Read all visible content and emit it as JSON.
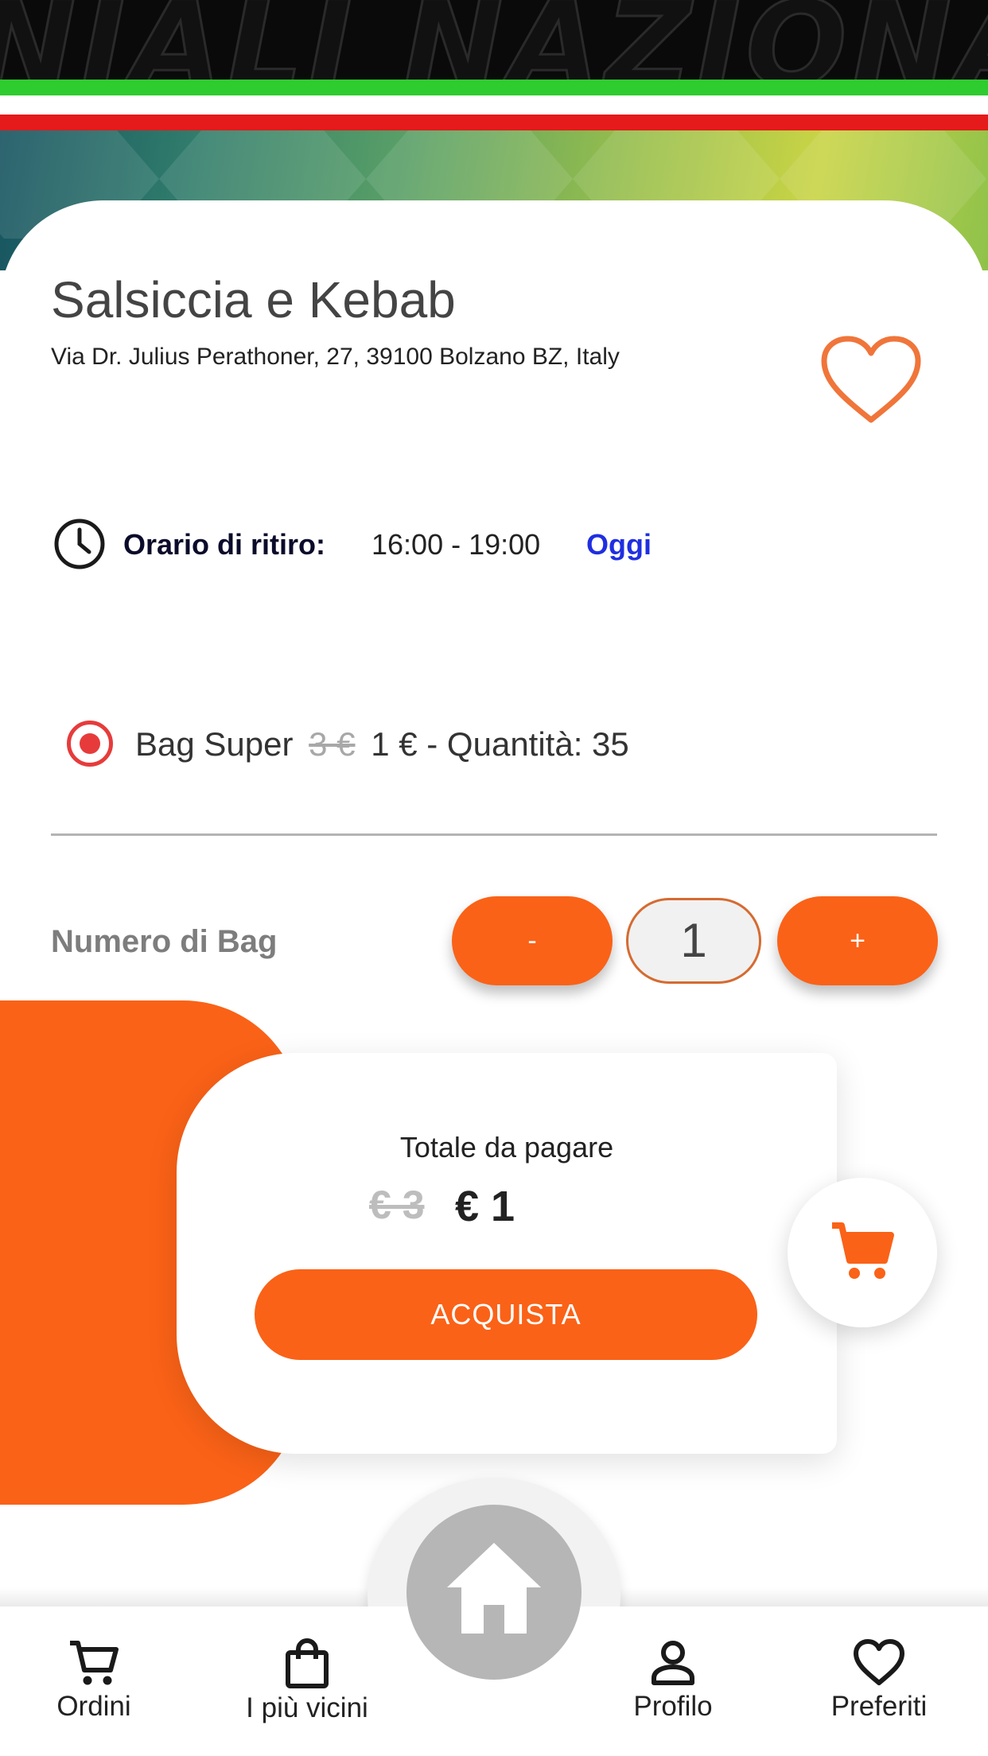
{
  "banner": {
    "text": "NIALI NAZIONALI"
  },
  "store": {
    "name": "Salsiccia e Kebab",
    "address": "Via Dr. Julius Perathoner, 27, 39100 Bolzano BZ, Italy"
  },
  "pickup": {
    "label": "Orario di ritiro:",
    "time": "16:00 - 19:00",
    "day": "Oggi"
  },
  "bag_option": {
    "name": "Bag Super",
    "old_price": "3 €",
    "new_price": "1 €",
    "quantity_text": "- Quantità: 35",
    "selected": true
  },
  "quantity": {
    "label": "Numero di  Bag",
    "minus": "-",
    "value": "1",
    "plus": "+"
  },
  "total": {
    "label": "Totale da pagare",
    "old_price": "€ 3",
    "new_price": "€ 1",
    "buy_label": "ACQUISTA"
  },
  "nav": {
    "items": [
      {
        "label": "Ordini",
        "icon": "cart-icon"
      },
      {
        "label": "I più vicini",
        "icon": "shopping-bag-icon"
      },
      {
        "label": "Profilo",
        "icon": "person-icon"
      },
      {
        "label": "Preferiti",
        "icon": "heart-icon"
      }
    ],
    "home_icon": "home-icon"
  },
  "colors": {
    "accent": "#fa6217",
    "radio": "#e73b3b",
    "today": "#1f2fe0",
    "home_button": "#b5b6b5"
  }
}
